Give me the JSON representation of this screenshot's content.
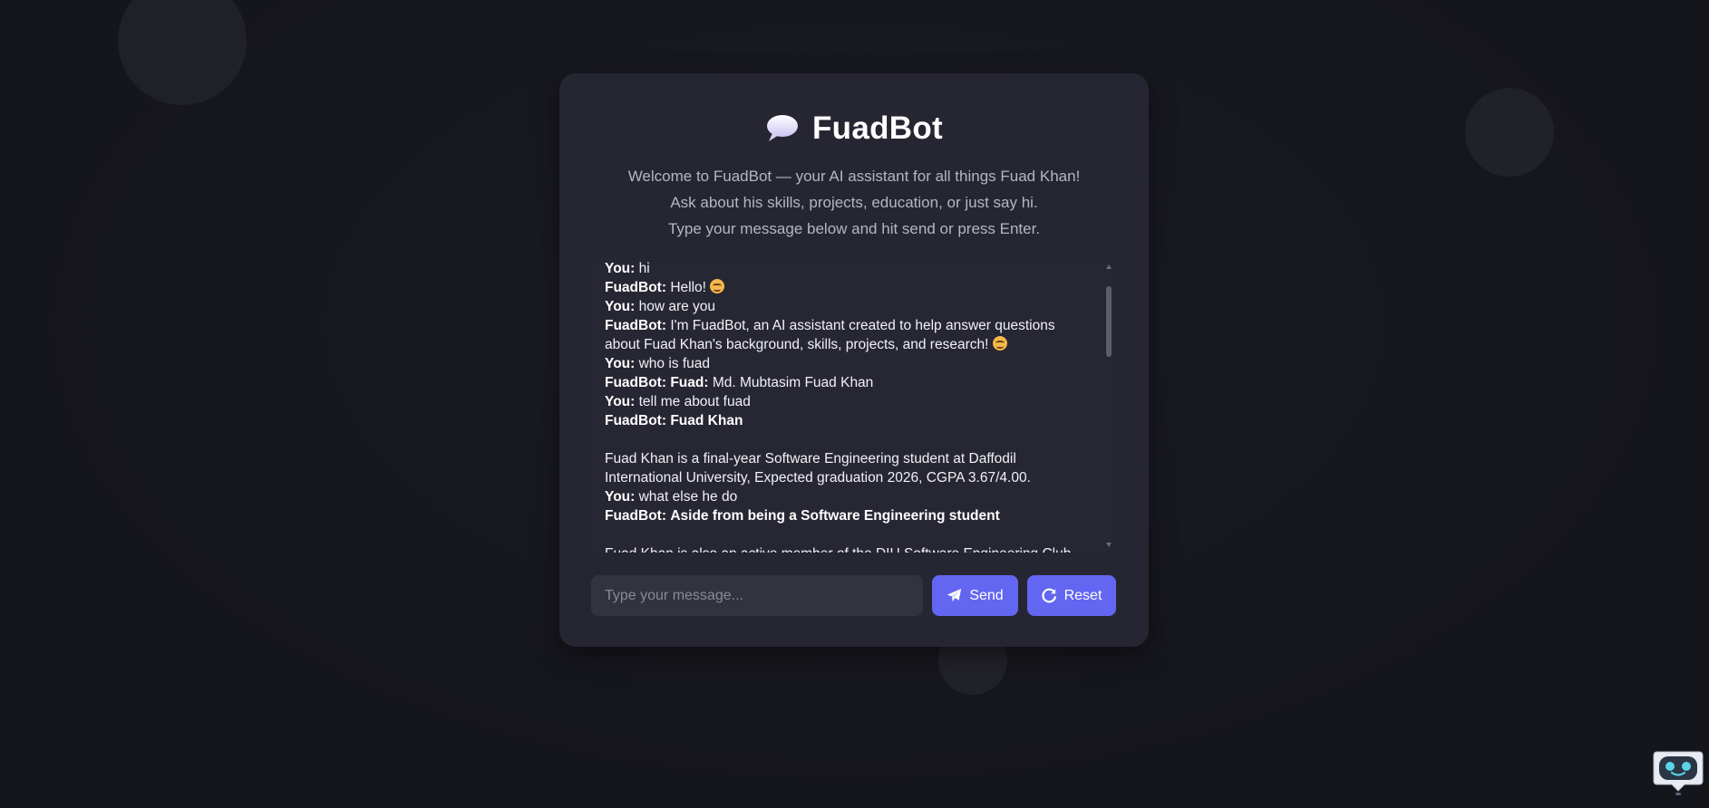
{
  "header": {
    "title": "FuadBot",
    "title_icon": "speech-bubble-icon"
  },
  "intro": {
    "line1": "Welcome to FuadBot — your AI assistant for all things Fuad Khan!",
    "line2": "Ask about his skills, projects, education, or just say hi.",
    "line3": "Type your message below and hit send or press Enter."
  },
  "chat": {
    "messages": [
      {
        "speaker": "You:",
        "text": "hi"
      },
      {
        "speaker": "FuadBot:",
        "text": "Hello!",
        "emoji": "smiling-face-icon"
      },
      {
        "speaker": "You:",
        "text": "how are you"
      },
      {
        "speaker": "FuadBot:",
        "text": "I'm FuadBot, an AI assistant created to help answer questions about Fuad Khan's background, skills, projects, and research!",
        "emoji": "smiling-face-icon"
      },
      {
        "speaker": "You:",
        "text": "who is fuad"
      },
      {
        "speaker": "FuadBot:",
        "bold_text": "Fuad:",
        "text": "Md. Mubtasim Fuad Khan"
      },
      {
        "speaker": "You:",
        "text": "tell me about fuad"
      },
      {
        "speaker": "FuadBot:",
        "bold_text": "Fuad Khan",
        "text": "",
        "continuation": "Fuad Khan is a final-year Software Engineering student at Daffodil International University, Expected graduation 2026, CGPA 3.67/4.00."
      },
      {
        "speaker": "You:",
        "text": "what else he do"
      },
      {
        "speaker": "FuadBot:",
        "bold_text": "Aside from being a Software Engineering student",
        "text": "",
        "continuation": "Fuad Khan is also an active member of the DIU Software Engineering Club"
      }
    ]
  },
  "input": {
    "placeholder": "Type your message...",
    "value": ""
  },
  "buttons": {
    "send_label": "Send",
    "reset_label": "Reset"
  },
  "colors": {
    "accent": "#6366f1",
    "background": "#15151c",
    "card": "#262633"
  },
  "floating_widget": {
    "icon": "robot-icon"
  }
}
